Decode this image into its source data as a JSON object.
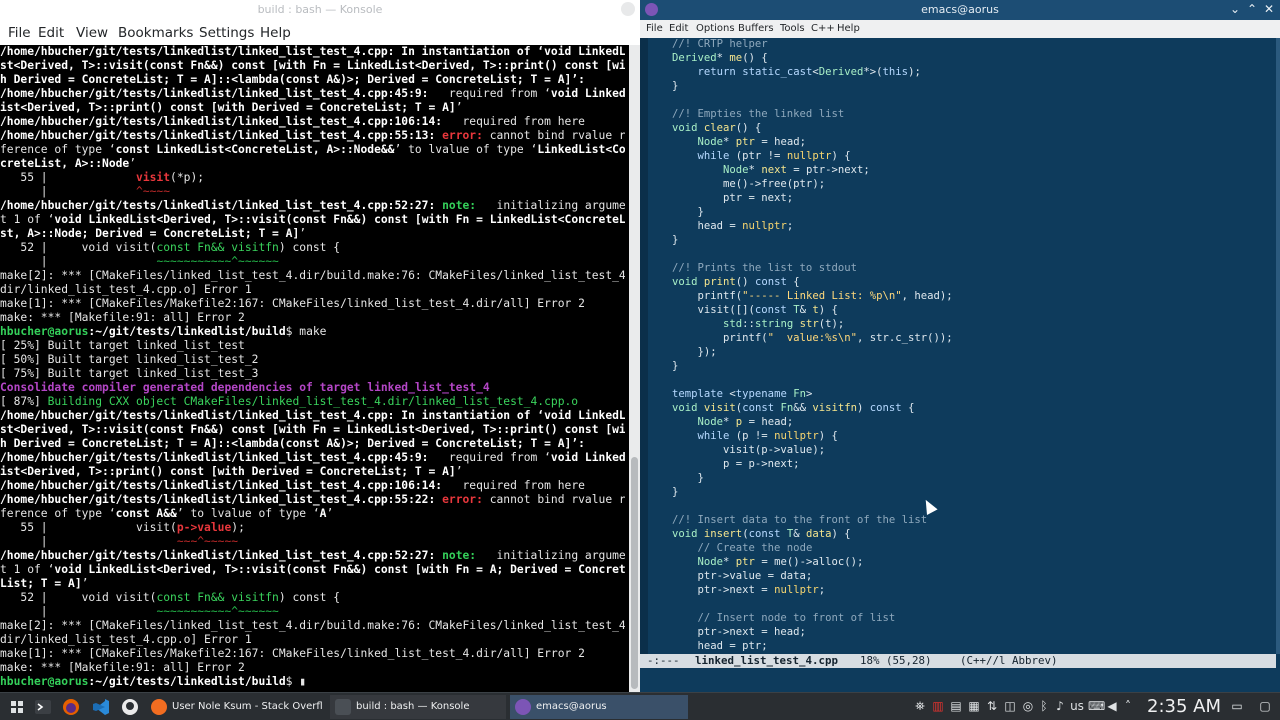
{
  "konsole": {
    "window_title": "build : bash — Konsole",
    "menu": [
      "File",
      "Edit",
      "View",
      "Bookmarks",
      "Settings",
      "Help"
    ],
    "lines": [
      [
        {
          "t": "/home/hbucher/git/tests/linkedlist/linked_list_test_4.cpp: In instantiation of ‘void LinkedLi",
          "c": "b"
        }
      ],
      [
        {
          "t": "st<Derived, T>::visit(const Fn&&) const [with Fn = LinkedList<Derived, T>::print() const [wit",
          "c": "b"
        }
      ],
      [
        {
          "t": "h Derived = ConcreteList; T = A]::<lambda(const A&)>; Derived = ConcreteList; T = A]’:",
          "c": "b"
        }
      ],
      [
        {
          "t": "/home/hbucher/git/tests/linkedlist/linked_list_test_4.cpp:45:9:",
          "c": "b"
        },
        {
          "t": "   required from ‘",
          "c": ""
        },
        {
          "t": "void LinkedL",
          "c": "b"
        }
      ],
      [
        {
          "t": "ist<Derived, T>::print() const [with Derived = ConcreteList; T = A]",
          "c": "b"
        },
        {
          "t": "’",
          "c": ""
        }
      ],
      [
        {
          "t": "/home/hbucher/git/tests/linkedlist/linked_list_test_4.cpp:106:14:",
          "c": "b"
        },
        {
          "t": "   required from here",
          "c": ""
        }
      ],
      [
        {
          "t": "/home/hbucher/git/tests/linkedlist/linked_list_test_4.cpp:55:13: ",
          "c": "b"
        },
        {
          "t": "error:",
          "c": "red"
        },
        {
          "t": " cannot bind rvalue re",
          "c": ""
        }
      ],
      [
        {
          "t": "ference of type ‘",
          "c": ""
        },
        {
          "t": "const LinkedList<ConcreteList, A>::Node&&",
          "c": "b"
        },
        {
          "t": "’ to lvalue of type ‘",
          "c": ""
        },
        {
          "t": "LinkedList<Con",
          "c": "b"
        }
      ],
      [
        {
          "t": "creteList, A>::Node",
          "c": "b"
        },
        {
          "t": "’",
          "c": ""
        }
      ],
      [
        {
          "t": "   55 |             ",
          "c": ""
        },
        {
          "t": "visit",
          "c": "red"
        },
        {
          "t": "(*p);",
          "c": ""
        }
      ],
      [
        {
          "t": "      |             ",
          "c": ""
        },
        {
          "t": "^~~~~",
          "c": "caret"
        }
      ],
      [
        {
          "t": "/home/hbucher/git/tests/linkedlist/linked_list_test_4.cpp:52:27: ",
          "c": "b"
        },
        {
          "t": "note:",
          "c": "grn"
        },
        {
          "t": "   initializing argumen",
          "c": ""
        }
      ],
      [
        {
          "t": "t 1 of ‘",
          "c": ""
        },
        {
          "t": "void LinkedList<Derived, T>::visit(const Fn&&) const [with Fn = LinkedList<ConcreteLi",
          "c": "b"
        }
      ],
      [
        {
          "t": "st, A>::Node; Derived = ConcreteList; T = A]",
          "c": "b"
        },
        {
          "t": "’",
          "c": ""
        }
      ],
      [
        {
          "t": "   52 |     void visit(",
          "c": ""
        },
        {
          "t": "const Fn&& visitfn",
          "c": "grn2"
        },
        {
          "t": ") const {",
          "c": ""
        }
      ],
      [
        {
          "t": "      |                ",
          "c": ""
        },
        {
          "t": "~~~~~~~~~~~^~~~~~~",
          "c": "tilde"
        }
      ],
      [
        {
          "t": "make[2]: *** [CMakeFiles/linked_list_test_4.dir/build.make:76: CMakeFiles/linked_list_test_4.",
          "c": ""
        }
      ],
      [
        {
          "t": "dir/linked_list_test_4.cpp.o] Error 1",
          "c": ""
        }
      ],
      [
        {
          "t": "make[1]: *** [CMakeFiles/Makefile2:167: CMakeFiles/linked_list_test_4.dir/all] Error 2",
          "c": ""
        }
      ],
      [
        {
          "t": "make: *** [Makefile:91: all] Error 2",
          "c": ""
        }
      ],
      [
        {
          "t": "hbucher@aorus",
          "c": "grn"
        },
        {
          "t": ":",
          "c": "b"
        },
        {
          "t": "~/git/tests/linkedlist/build",
          "c": "b"
        },
        {
          "t": "$ make",
          "c": ""
        }
      ],
      [
        {
          "t": "[ 25%] Built target linked_list_test",
          "c": ""
        }
      ],
      [
        {
          "t": "[ 50%] Built target linked_list_test_2",
          "c": ""
        }
      ],
      [
        {
          "t": "[ 75%] Built target linked_list_test_3",
          "c": ""
        }
      ],
      [
        {
          "t": "Consolidate compiler generated dependencies of target linked_list_test_4",
          "c": "mag"
        }
      ],
      [
        {
          "t": "[ 87%] ",
          "c": ""
        },
        {
          "t": "Building CXX object CMakeFiles/linked_list_test_4.dir/linked_list_test_4.cpp.o",
          "c": "grn2"
        }
      ],
      [
        {
          "t": "/home/hbucher/git/tests/linkedlist/linked_list_test_4.cpp: In instantiation of ‘void LinkedLi",
          "c": "b"
        }
      ],
      [
        {
          "t": "st<Derived, T>::visit(const Fn&&) const [with Fn = LinkedList<Derived, T>::print() const [wit",
          "c": "b"
        }
      ],
      [
        {
          "t": "h Derived = ConcreteList; T = A]::<lambda(const A&)>; Derived = ConcreteList; T = A]’:",
          "c": "b"
        }
      ],
      [
        {
          "t": "/home/hbucher/git/tests/linkedlist/linked_list_test_4.cpp:45:9:",
          "c": "b"
        },
        {
          "t": "   required from ‘",
          "c": ""
        },
        {
          "t": "void LinkedL",
          "c": "b"
        }
      ],
      [
        {
          "t": "ist<Derived, T>::print() const [with Derived = ConcreteList; T = A]",
          "c": "b"
        },
        {
          "t": "’",
          "c": ""
        }
      ],
      [
        {
          "t": "/home/hbucher/git/tests/linkedlist/linked_list_test_4.cpp:106:14:",
          "c": "b"
        },
        {
          "t": "   required from here",
          "c": ""
        }
      ],
      [
        {
          "t": "/home/hbucher/git/tests/linkedlist/linked_list_test_4.cpp:55:22: ",
          "c": "b"
        },
        {
          "t": "error:",
          "c": "red"
        },
        {
          "t": " cannot bind rvalue re",
          "c": ""
        }
      ],
      [
        {
          "t": "ference of type ‘",
          "c": ""
        },
        {
          "t": "const A&&",
          "c": "b"
        },
        {
          "t": "’ to lvalue of type ‘",
          "c": ""
        },
        {
          "t": "A",
          "c": "b"
        },
        {
          "t": "’",
          "c": ""
        }
      ],
      [
        {
          "t": "   55 |             visit(",
          "c": ""
        },
        {
          "t": "p->value",
          "c": "red"
        },
        {
          "t": ");",
          "c": ""
        }
      ],
      [
        {
          "t": "      |                   ",
          "c": ""
        },
        {
          "t": "~~~^~~~~~",
          "c": "caret"
        }
      ],
      [
        {
          "t": "/home/hbucher/git/tests/linkedlist/linked_list_test_4.cpp:52:27: ",
          "c": "b"
        },
        {
          "t": "note:",
          "c": "grn"
        },
        {
          "t": "   initializing argumen",
          "c": ""
        }
      ],
      [
        {
          "t": "t 1 of ‘",
          "c": ""
        },
        {
          "t": "void LinkedList<Derived, T>::visit(const Fn&&) const [with Fn = A; Derived = Concrete",
          "c": "b"
        }
      ],
      [
        {
          "t": "List; T = A]",
          "c": "b"
        },
        {
          "t": "’",
          "c": ""
        }
      ],
      [
        {
          "t": "   52 |     void visit(",
          "c": ""
        },
        {
          "t": "const Fn&& visitfn",
          "c": "grn2"
        },
        {
          "t": ") const {",
          "c": ""
        }
      ],
      [
        {
          "t": "      |                ",
          "c": ""
        },
        {
          "t": "~~~~~~~~~~~^~~~~~~",
          "c": "tilde"
        }
      ],
      [
        {
          "t": "make[2]: *** [CMakeFiles/linked_list_test_4.dir/build.make:76: CMakeFiles/linked_list_test_4.",
          "c": ""
        }
      ],
      [
        {
          "t": "dir/linked_list_test_4.cpp.o] Error 1",
          "c": ""
        }
      ],
      [
        {
          "t": "make[1]: *** [CMakeFiles/Makefile2:167: CMakeFiles/linked_list_test_4.dir/all] Error 2",
          "c": ""
        }
      ],
      [
        {
          "t": "make: *** [Makefile:91: all] Error 2",
          "c": ""
        }
      ],
      [
        {
          "t": "hbucher@aorus",
          "c": "grn"
        },
        {
          "t": ":",
          "c": "b"
        },
        {
          "t": "~/git/tests/linkedlist/build",
          "c": "b"
        },
        {
          "t": "$ ▮",
          "c": ""
        }
      ]
    ]
  },
  "emacs": {
    "window_title": "emacs@aorus",
    "menu": [
      "File",
      "Edit",
      "Options",
      "Buffers",
      "Tools",
      "C++",
      "Help"
    ],
    "code": [
      [
        {
          "t": "//! CRTP helper",
          "c": "cm"
        }
      ],
      [
        {
          "t": "Derived",
          "c": "ty"
        },
        {
          "t": "* ",
          "c": ""
        },
        {
          "t": "me",
          "c": "fn"
        },
        {
          "t": "() {",
          "c": ""
        }
      ],
      [
        {
          "t": "    ",
          "c": ""
        },
        {
          "t": "return",
          "c": "kw"
        },
        {
          "t": " ",
          "c": ""
        },
        {
          "t": "static_cast",
          "c": "kw"
        },
        {
          "t": "<",
          "c": ""
        },
        {
          "t": "Derived",
          "c": "ty"
        },
        {
          "t": "*>(",
          "c": ""
        },
        {
          "t": "this",
          "c": "kw"
        },
        {
          "t": ");",
          "c": ""
        }
      ],
      [
        {
          "t": "}",
          "c": ""
        }
      ],
      [
        {
          "t": "",
          "c": ""
        }
      ],
      [
        {
          "t": "//! Empties the linked list",
          "c": "cm"
        }
      ],
      [
        {
          "t": "void",
          "c": "ty"
        },
        {
          "t": " ",
          "c": ""
        },
        {
          "t": "clear",
          "c": "fn"
        },
        {
          "t": "() {",
          "c": ""
        }
      ],
      [
        {
          "t": "    ",
          "c": ""
        },
        {
          "t": "Node",
          "c": "ty"
        },
        {
          "t": "* ",
          "c": ""
        },
        {
          "t": "ptr",
          "c": "fn"
        },
        {
          "t": " = head;",
          "c": ""
        }
      ],
      [
        {
          "t": "    ",
          "c": ""
        },
        {
          "t": "while",
          "c": "kw"
        },
        {
          "t": " (ptr != ",
          "c": ""
        },
        {
          "t": "nullptr",
          "c": "cs"
        },
        {
          "t": ") {",
          "c": ""
        }
      ],
      [
        {
          "t": "        ",
          "c": ""
        },
        {
          "t": "Node",
          "c": "ty"
        },
        {
          "t": "* ",
          "c": ""
        },
        {
          "t": "next",
          "c": "fn"
        },
        {
          "t": " = ptr->next;",
          "c": ""
        }
      ],
      [
        {
          "t": "        me()->free(ptr);",
          "c": ""
        }
      ],
      [
        {
          "t": "        ptr = next;",
          "c": ""
        }
      ],
      [
        {
          "t": "    }",
          "c": ""
        }
      ],
      [
        {
          "t": "    head = ",
          "c": ""
        },
        {
          "t": "nullptr",
          "c": "cs"
        },
        {
          "t": ";",
          "c": ""
        }
      ],
      [
        {
          "t": "}",
          "c": ""
        }
      ],
      [
        {
          "t": "",
          "c": ""
        }
      ],
      [
        {
          "t": "//! Prints the list to stdout",
          "c": "cm"
        }
      ],
      [
        {
          "t": "void",
          "c": "ty"
        },
        {
          "t": " ",
          "c": ""
        },
        {
          "t": "print",
          "c": "fn"
        },
        {
          "t": "() ",
          "c": ""
        },
        {
          "t": "const",
          "c": "kw"
        },
        {
          "t": " {",
          "c": ""
        }
      ],
      [
        {
          "t": "    printf(",
          "c": ""
        },
        {
          "t": "\"----- Linked List: %p\\n\"",
          "c": "st"
        },
        {
          "t": ", head);",
          "c": ""
        }
      ],
      [
        {
          "t": "    visit([](",
          "c": ""
        },
        {
          "t": "const",
          "c": "kw"
        },
        {
          "t": " ",
          "c": ""
        },
        {
          "t": "T",
          "c": "ty"
        },
        {
          "t": "& ",
          "c": ""
        },
        {
          "t": "t",
          "c": "fn"
        },
        {
          "t": ") {",
          "c": ""
        }
      ],
      [
        {
          "t": "        ",
          "c": ""
        },
        {
          "t": "std",
          "c": "ty"
        },
        {
          "t": "::",
          "c": ""
        },
        {
          "t": "string",
          "c": "ty"
        },
        {
          "t": " ",
          "c": ""
        },
        {
          "t": "str",
          "c": "fn"
        },
        {
          "t": "(t);",
          "c": ""
        }
      ],
      [
        {
          "t": "        printf(",
          "c": ""
        },
        {
          "t": "\"  value:%s\\n\"",
          "c": "st"
        },
        {
          "t": ", str.c_str());",
          "c": ""
        }
      ],
      [
        {
          "t": "    });",
          "c": ""
        }
      ],
      [
        {
          "t": "}",
          "c": ""
        }
      ],
      [
        {
          "t": "",
          "c": ""
        }
      ],
      [
        {
          "t": "template",
          "c": "kw"
        },
        {
          "t": " <",
          "c": ""
        },
        {
          "t": "typename",
          "c": "kw"
        },
        {
          "t": " ",
          "c": ""
        },
        {
          "t": "Fn",
          "c": "ty"
        },
        {
          "t": ">",
          "c": ""
        }
      ],
      [
        {
          "t": "void",
          "c": "ty"
        },
        {
          "t": " ",
          "c": ""
        },
        {
          "t": "visit",
          "c": "fn"
        },
        {
          "t": "(",
          "c": ""
        },
        {
          "t": "const",
          "c": "kw"
        },
        {
          "t": " ",
          "c": ""
        },
        {
          "t": "Fn",
          "c": "ty"
        },
        {
          "t": "&& ",
          "c": ""
        },
        {
          "t": "visitfn",
          "c": "fn"
        },
        {
          "t": ") ",
          "c": ""
        },
        {
          "t": "const",
          "c": "kw"
        },
        {
          "t": " {",
          "c": ""
        }
      ],
      [
        {
          "t": "    ",
          "c": ""
        },
        {
          "t": "Node",
          "c": "ty"
        },
        {
          "t": "* ",
          "c": ""
        },
        {
          "t": "p",
          "c": "fn"
        },
        {
          "t": " = head;",
          "c": ""
        }
      ],
      [
        {
          "t": "    ",
          "c": ""
        },
        {
          "t": "while",
          "c": "kw"
        },
        {
          "t": " (p != ",
          "c": ""
        },
        {
          "t": "nullptr",
          "c": "cs"
        },
        {
          "t": ") {",
          "c": ""
        }
      ],
      [
        {
          "t": "        visit(p->value);",
          "c": ""
        }
      ],
      [
        {
          "t": "        p = p->next;",
          "c": ""
        }
      ],
      [
        {
          "t": "    }",
          "c": ""
        }
      ],
      [
        {
          "t": "}",
          "c": ""
        }
      ],
      [
        {
          "t": "",
          "c": ""
        }
      ],
      [
        {
          "t": "//! Insert data to the front of the list",
          "c": "cm"
        }
      ],
      [
        {
          "t": "void",
          "c": "ty"
        },
        {
          "t": " ",
          "c": ""
        },
        {
          "t": "insert",
          "c": "fn"
        },
        {
          "t": "(",
          "c": ""
        },
        {
          "t": "const",
          "c": "kw"
        },
        {
          "t": " ",
          "c": ""
        },
        {
          "t": "T",
          "c": "ty"
        },
        {
          "t": "& ",
          "c": ""
        },
        {
          "t": "data",
          "c": "fn"
        },
        {
          "t": ") {",
          "c": ""
        }
      ],
      [
        {
          "t": "    ",
          "c": ""
        },
        {
          "t": "// Create the node",
          "c": "cm"
        }
      ],
      [
        {
          "t": "    ",
          "c": ""
        },
        {
          "t": "Node",
          "c": "ty"
        },
        {
          "t": "* ",
          "c": ""
        },
        {
          "t": "ptr",
          "c": "fn"
        },
        {
          "t": " = me()->alloc();",
          "c": ""
        }
      ],
      [
        {
          "t": "    ptr->value = data;",
          "c": ""
        }
      ],
      [
        {
          "t": "    ptr->next = ",
          "c": ""
        },
        {
          "t": "nullptr",
          "c": "cs"
        },
        {
          "t": ";",
          "c": ""
        }
      ],
      [
        {
          "t": "",
          "c": ""
        }
      ],
      [
        {
          "t": "    ",
          "c": ""
        },
        {
          "t": "// Insert node to front of list",
          "c": "cm"
        }
      ],
      [
        {
          "t": "    ptr->next = head;",
          "c": ""
        }
      ],
      [
        {
          "t": "    head = ptr;",
          "c": ""
        }
      ]
    ],
    "modeline": {
      "status": "-:---",
      "buffer": "linked_list_test_4.cpp",
      "position": "18% (55,28)",
      "modes": "(C++//l Abbrev)"
    }
  },
  "taskbar": {
    "tasks": [
      {
        "label": "User Nole Ksum - Stack Overflow ...",
        "color": "#f26d21"
      },
      {
        "label": "build : bash — Konsole",
        "color": "#4a4f55"
      },
      {
        "label": "emacs@aorus",
        "color": "#7c55b6"
      }
    ],
    "tray_text": "us",
    "clock": "2:35 AM"
  }
}
